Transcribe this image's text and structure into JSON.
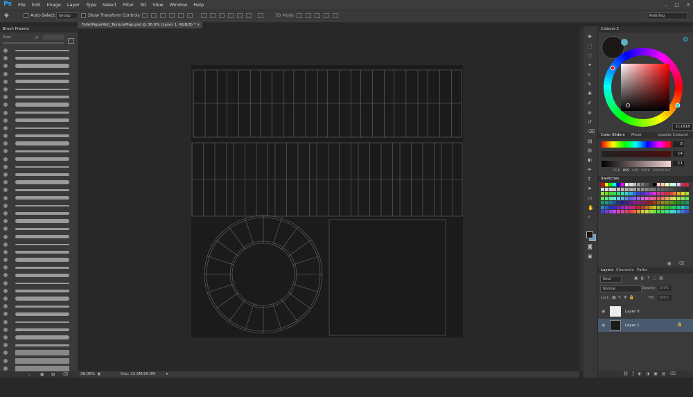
{
  "app": {
    "logo": "Ps"
  },
  "menu": [
    "File",
    "Edit",
    "Image",
    "Layer",
    "Type",
    "Select",
    "Filter",
    "3D",
    "View",
    "Window",
    "Help"
  ],
  "window_controls": [
    "–",
    "□",
    "✕"
  ],
  "options": {
    "auto_select": "Auto-Select:",
    "group": "Group",
    "show_transform": "Show Transform Controls",
    "mode_3d": "3D Mode:",
    "workspace": "Painting"
  },
  "brush_panel": {
    "title": "Brush Presets",
    "size_label": "Size:"
  },
  "document": {
    "tab": "ToiletPaperRoll_TextureMap.psd @ 36.9% (Layer 1, RGB/8) *",
    "close": "×"
  },
  "status": {
    "zoom": "36.06%",
    "doc": "Doc: 12.0M/16.0M"
  },
  "colours": {
    "title": "Colours 2",
    "hex": "1C1818"
  },
  "color_sliders": {
    "tabs": [
      "Color Sliders",
      "Mixer",
      "Update Colours!"
    ],
    "values": [
      "8",
      "14",
      "11"
    ],
    "modes": [
      "RGB",
      "HSV",
      "LAB",
      "CMYK",
      "GRAYSCALE"
    ]
  },
  "swatches": {
    "title": "Swatches"
  },
  "layers": {
    "tabs": [
      "Layers",
      "Channels",
      "Paths"
    ],
    "kind": "Kind",
    "blend": "Normal",
    "opacity_label": "Opacity:",
    "opacity": "100%",
    "lock_label": "Lock:",
    "fill_label": "Fill:",
    "fill": "100%",
    "items": [
      "Layer 0",
      "Layer 1"
    ]
  },
  "colors": {
    "accent": "#31a8ff",
    "selected_layer": "#4a5a6e"
  }
}
